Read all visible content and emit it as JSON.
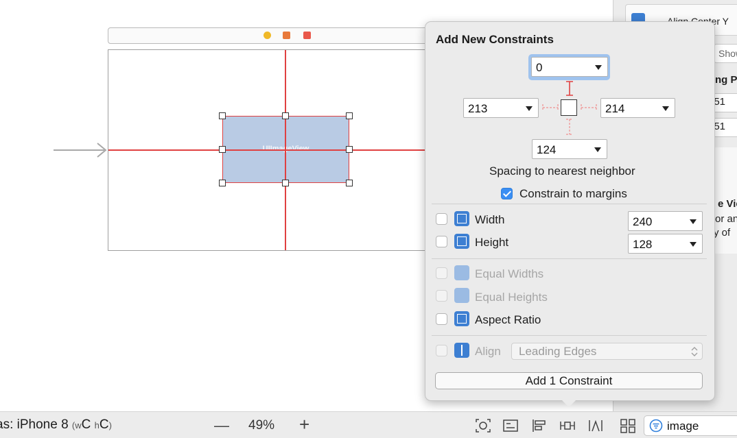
{
  "canvas": {
    "imageview_label": "UIImageView"
  },
  "inspector": {
    "top_label": "Align Center Y",
    "show_label": "Show",
    "priority_label": "ng Pr",
    "value1": "251",
    "value2": "251",
    "brace": "{",
    "view_title": "e View",
    "desc1": "or an",
    "desc2": "y of"
  },
  "popover": {
    "title": "Add New Constraints",
    "top_value": "0",
    "left_value": "213",
    "right_value": "214",
    "bottom_value": "124",
    "spacing_label": "Spacing to nearest neighbor",
    "constrain_margins_label": "Constrain to margins",
    "constrain_margins_checked": true,
    "width": {
      "label": "Width",
      "value": "240",
      "checked": false
    },
    "height": {
      "label": "Height",
      "value": "128",
      "checked": false
    },
    "equal_widths_label": "Equal Widths",
    "equal_heights_label": "Equal Heights",
    "aspect_ratio_label": "Aspect Ratio",
    "align_label": "Align",
    "align_value": "Leading Edges",
    "add_button_label": "Add 1 Constraint"
  },
  "bottom_bar": {
    "device_prefix": "as: iPhone 8",
    "size_class_w": "w",
    "size_class_w_val": "C",
    "size_class_h": "h",
    "size_class_h_val": "C",
    "zoom_out": "—",
    "zoom_level": "49%",
    "zoom_in": "+",
    "filter_text": "image"
  },
  "colors": {
    "constraint_red": "#e04040",
    "accent_blue": "#3a8ef3",
    "image_view_fill": "#b9cbe4"
  }
}
